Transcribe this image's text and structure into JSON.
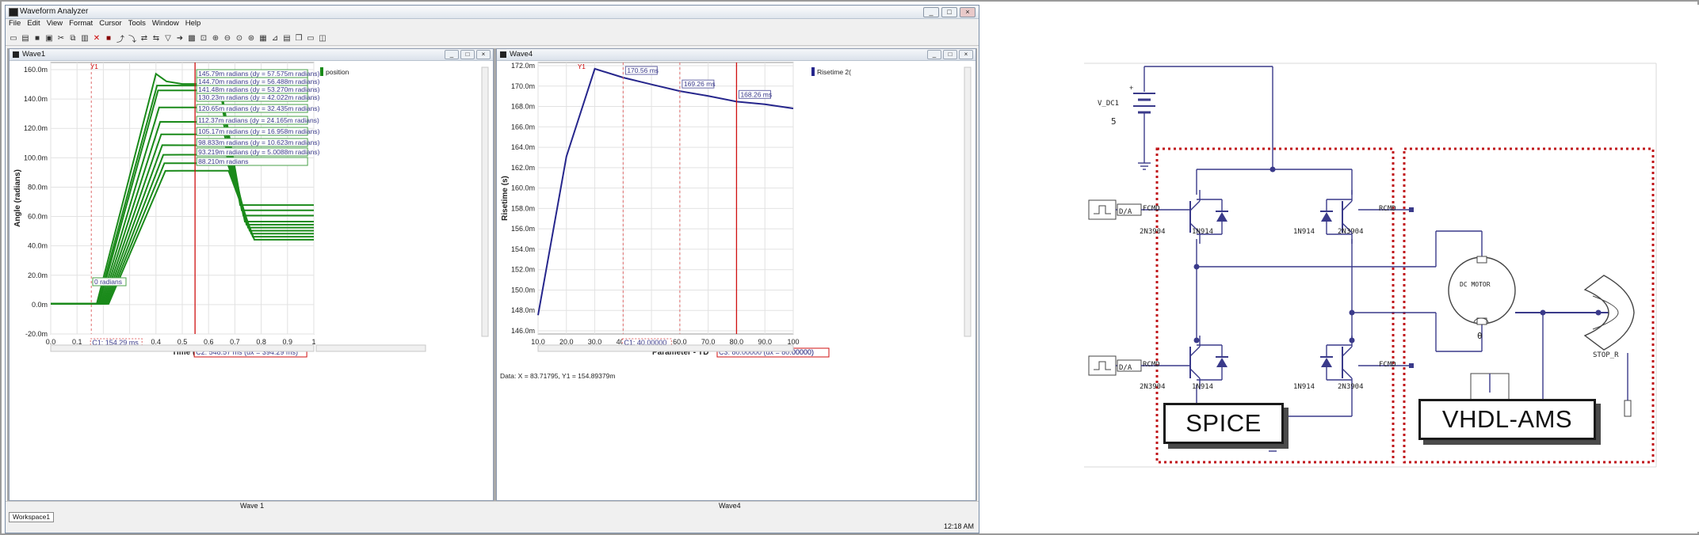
{
  "app": {
    "title": "Waveform Analyzer",
    "menu": [
      "File",
      "Edit",
      "View",
      "Format",
      "Cursor",
      "Tools",
      "Window",
      "Help"
    ],
    "window_buttons": [
      "_",
      "□",
      "×"
    ]
  },
  "wave1": {
    "title": "Wave1",
    "footer_label": "Wave 1",
    "legend": "position",
    "ylabel": "Angle (radians)",
    "xlabel": "Time (s)",
    "cursor_y1": "Y1",
    "cursor_c1": "C1: 154.29 ms",
    "cursor_c2": "C2: 548.57 ms (dx = 394.29 ms)",
    "y_ticks": [
      "160.0m",
      "140.0m",
      "120.0m",
      "100.0m",
      "80.0m",
      "60.0m",
      "40.0m",
      "20.0m",
      "0.0m",
      "-20.0m"
    ],
    "x_ticks": [
      "0.0",
      "0.1",
      "0.2",
      "0.3",
      "0.4",
      "0.5",
      "0.6",
      "0.7",
      "0.8",
      "0.9",
      "1"
    ],
    "markers": [
      "145.79m radians (dy = 57.575m radians)",
      "144.70m radians (dy = 56.488m radians)",
      "141.48m radians (dy = 53.270m radians)",
      "130.23m radians (dy = 42.022m radians)",
      "120.65m radians (dy = 32.435m radians)",
      "112.37m radians (dy = 24.165m radians)",
      "105.17m radians (dy = 16.958m radians)",
      "98.833m radians (dy = 10.623m radians)",
      "93.219m radians (dy = 5.0088m radians)",
      "88.210m radians",
      "0 radians"
    ]
  },
  "wave4": {
    "title": "Wave4",
    "footer_label": "Wave4",
    "legend": "Risetime 2(",
    "ylabel": "Risetime (s)",
    "xlabel": "Parameter - YD",
    "cursor_y1": "Y1",
    "cursor_c1": "C1: 40.00000",
    "cursor_c3": "C3: 80.00000 (dx = 80.00000)",
    "c3_overflow": "00000)",
    "y_ticks": [
      "172.0m",
      "170.0m",
      "168.0m",
      "166.0m",
      "164.0m",
      "162.0m",
      "160.0m",
      "158.0m",
      "156.0m",
      "154.0m",
      "152.0m",
      "150.0m",
      "148.0m",
      "146.0m"
    ],
    "x_ticks": [
      "10.0",
      "20.0",
      "30.0",
      "40.0",
      "50.0",
      "60.0",
      "70.0",
      "80.0",
      "90.0",
      "100"
    ],
    "markers": [
      "170.56 ms",
      "169.26 ms",
      "168.26 ms"
    ],
    "status": "Data: X = 83.71795,   Y1 = 154.89379m"
  },
  "workspace_tab": "Workspace1",
  "clock": "12:18 AM",
  "chart_data": [
    {
      "type": "line",
      "title": "",
      "xlabel": "Time (s)",
      "ylabel": "Angle (radians)",
      "xlim": [
        0,
        1
      ],
      "ylim": [
        -0.02,
        0.16
      ],
      "grid": true,
      "legend": "top-right",
      "series": [
        {
          "name": "position",
          "color": "#1a8a1a",
          "peak": 0.1525,
          "hold": 0.14579,
          "final": 0.0655,
          "rise_start": 0.175
        },
        {
          "color": "#1a8a1a",
          "peak": 0.1447,
          "hold": 0.1447,
          "final": 0.062,
          "rise_start": 0.18
        },
        {
          "color": "#1a8a1a",
          "peak": 0.1415,
          "hold": 0.14148,
          "final": 0.0585,
          "rise_start": 0.185
        },
        {
          "color": "#1a8a1a",
          "peak": 0.1302,
          "hold": 0.13023,
          "final": 0.0545,
          "rise_start": 0.19
        },
        {
          "color": "#1a8a1a",
          "peak": 0.1207,
          "hold": 0.12065,
          "final": 0.0525,
          "rise_start": 0.195
        },
        {
          "color": "#1a8a1a",
          "peak": 0.1124,
          "hold": 0.11237,
          "final": 0.0505,
          "rise_start": 0.2
        },
        {
          "color": "#1a8a1a",
          "peak": 0.1052,
          "hold": 0.10517,
          "final": 0.0485,
          "rise_start": 0.205
        },
        {
          "color": "#1a8a1a",
          "peak": 0.0988,
          "hold": 0.098833,
          "final": 0.0465,
          "rise_start": 0.21
        },
        {
          "color": "#1a8a1a",
          "peak": 0.0932,
          "hold": 0.093219,
          "final": 0.0445,
          "rise_start": 0.215
        },
        {
          "color": "#1a8a1a",
          "peak": 0.0882,
          "hold": 0.08821,
          "final": 0.0425,
          "rise_start": 0.22
        }
      ],
      "cursors_x": [
        0.15429,
        0.54857
      ]
    },
    {
      "type": "line",
      "title": "",
      "xlabel": "Parameter - YD",
      "ylabel": "Risetime (s)",
      "xlim": [
        10,
        100
      ],
      "ylim": [
        0.146,
        0.172
      ],
      "grid": true,
      "legend": "top-right",
      "series": [
        {
          "name": "Risetime 2(",
          "color": "#26268c",
          "x": [
            10,
            20,
            30,
            40,
            50,
            60,
            70,
            80,
            90,
            100
          ],
          "y": [
            0.1478,
            0.163,
            0.1714,
            0.17056,
            0.1699,
            0.16926,
            0.1688,
            0.16826,
            0.168,
            0.1676
          ]
        }
      ],
      "cursors_x": [
        40,
        60,
        80
      ]
    }
  ],
  "schematic": {
    "spice_label": "SPICE",
    "vhdl_label": "VHDL-AMS",
    "voltage_source": "V_DC1",
    "voltage_value": "5",
    "forward_cmd": "FCMD",
    "reverse_cmd": "RCMD",
    "converter": "D/A",
    "transistor": "2N3904",
    "diode": "1N914",
    "motor": "DC MOTOR",
    "stop_label": "STOP_R",
    "theta": "θ",
    "colors": {
      "wire": "#3a3a8a",
      "boundary": "#c0151a",
      "box_border": "#1a1a1a"
    }
  }
}
